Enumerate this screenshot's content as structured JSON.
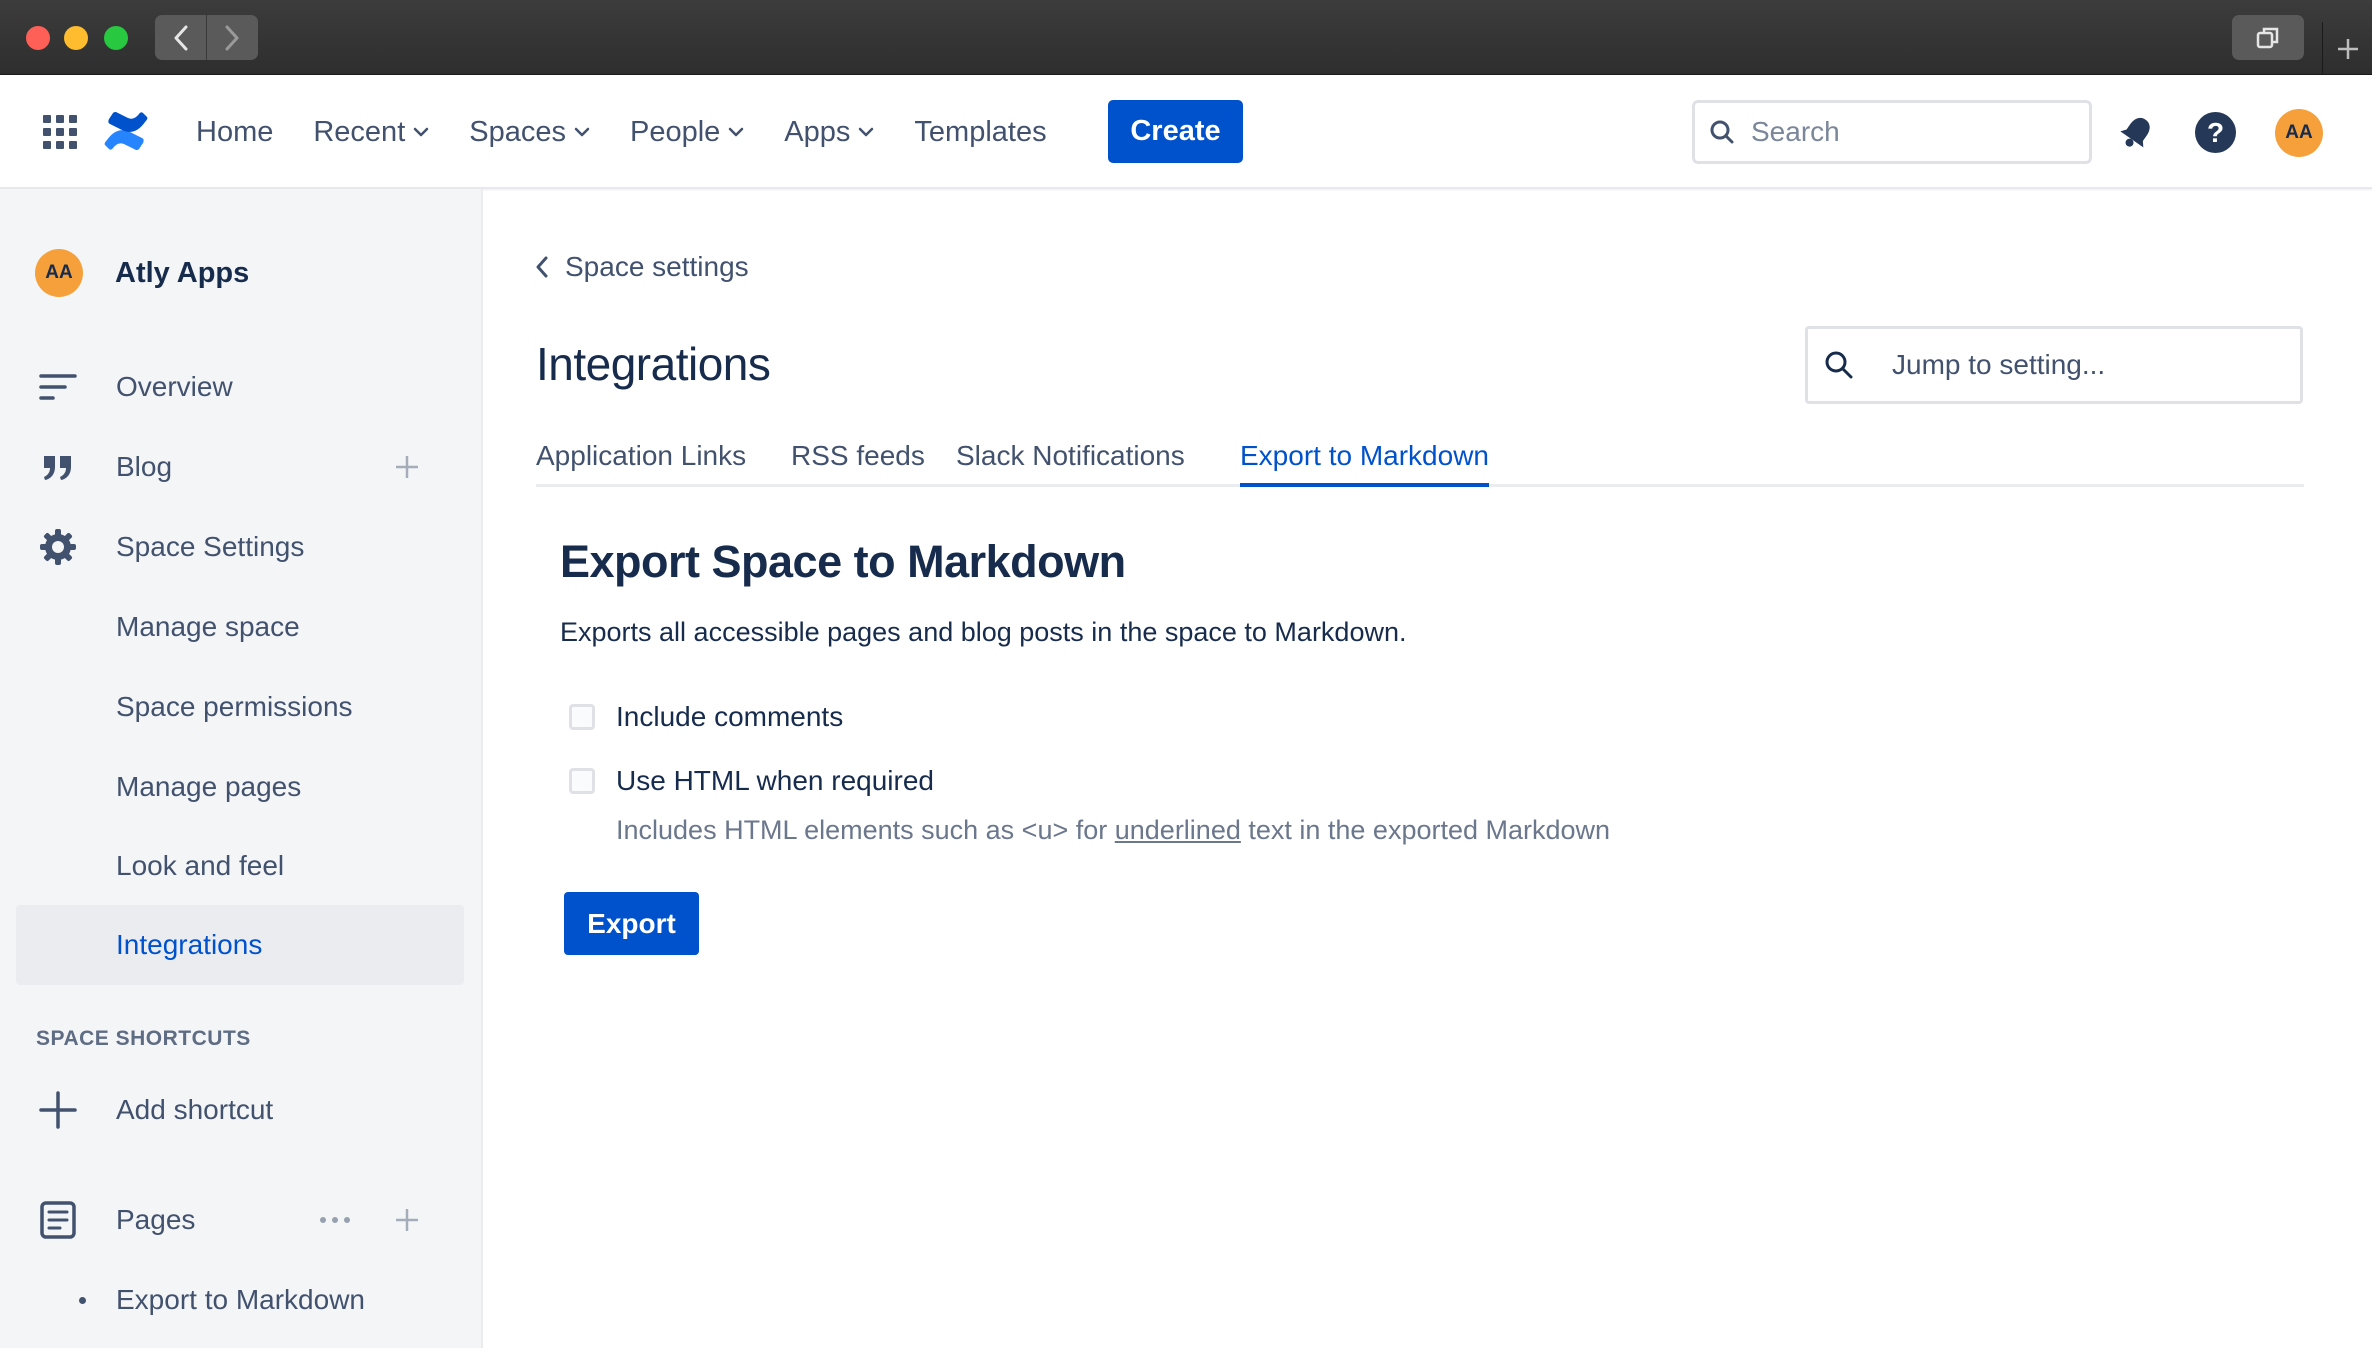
{
  "colors": {
    "accent": "#0052cc",
    "avatar": "#f5a03a",
    "sidebar_bg": "#f4f5f7",
    "nav_text": "#42526e"
  },
  "topnav": {
    "links": [
      {
        "label": "Home",
        "has_chevron": false
      },
      {
        "label": "Recent",
        "has_chevron": true
      },
      {
        "label": "Spaces",
        "has_chevron": true
      },
      {
        "label": "People",
        "has_chevron": true
      },
      {
        "label": "Apps",
        "has_chevron": true
      },
      {
        "label": "Templates",
        "has_chevron": false
      }
    ],
    "create_label": "Create",
    "search_placeholder": "Search",
    "help_glyph": "?",
    "avatar_initials": "AA"
  },
  "sidebar": {
    "space_avatar": "AA",
    "space_name": "Atly Apps",
    "items": {
      "overview": "Overview",
      "blog": "Blog",
      "space_settings": "Space Settings",
      "manage_space": "Manage space",
      "space_permissions": "Space permissions",
      "manage_pages": "Manage pages",
      "look_and_feel": "Look and feel",
      "integrations": "Integrations"
    },
    "shortcuts_title": "SPACE SHORTCUTS",
    "add_shortcut": "Add shortcut",
    "pages": "Pages",
    "page_children": [
      "Export to Markdown"
    ]
  },
  "main": {
    "breadcrumb": "Space settings",
    "title": "Integrations",
    "jump_placeholder": "Jump to setting...",
    "tabs": [
      {
        "label": "Application Links",
        "active": false
      },
      {
        "label": "RSS feeds",
        "active": false
      },
      {
        "label": "Slack Notifications",
        "active": false
      },
      {
        "label": "Export to Markdown",
        "active": true
      }
    ],
    "section_title": "Export Space to Markdown",
    "description": "Exports all accessible pages and blog posts in the space to Markdown.",
    "options": [
      {
        "label": "Include comments",
        "checked": false
      },
      {
        "label": "Use HTML when required",
        "checked": false
      }
    ],
    "help_text_before": "Includes HTML elements such as <u> for ",
    "help_text_underlined": "underlined",
    "help_text_after": " text in the exported Markdown",
    "export_label": "Export"
  }
}
